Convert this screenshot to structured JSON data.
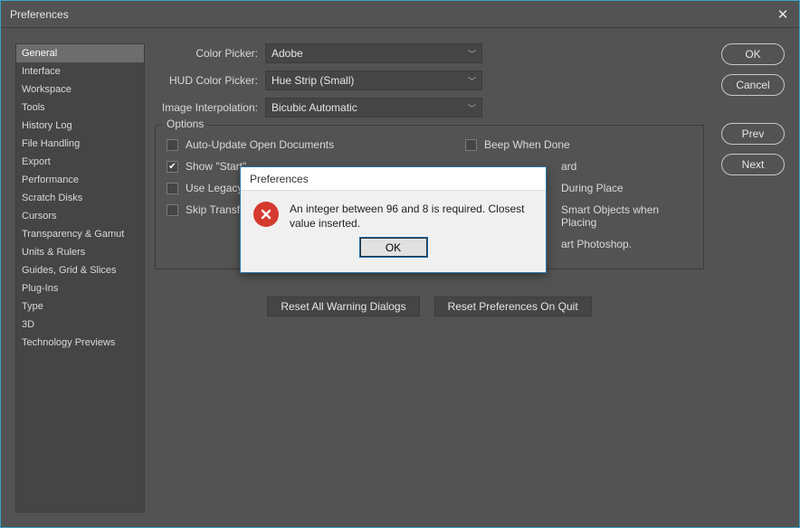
{
  "window": {
    "title": "Preferences"
  },
  "sidebar": {
    "items": [
      "General",
      "Interface",
      "Workspace",
      "Tools",
      "History Log",
      "File Handling",
      "Export",
      "Performance",
      "Scratch Disks",
      "Cursors",
      "Transparency & Gamut",
      "Units & Rulers",
      "Guides, Grid & Slices",
      "Plug-Ins",
      "Type",
      "3D",
      "Technology Previews"
    ],
    "selected_index": 0
  },
  "form": {
    "color_picker": {
      "label": "Color Picker:",
      "value": "Adobe"
    },
    "hud_color_picker": {
      "label": "HUD Color Picker:",
      "value": "Hue Strip (Small)"
    },
    "image_interpolation": {
      "label": "Image Interpolation:",
      "value": "Bicubic Automatic"
    }
  },
  "options": {
    "legend": "Options",
    "left": [
      {
        "label": "Auto-Update Open Documents",
        "checked": false
      },
      {
        "label": "Show \"Start\"",
        "checked": true,
        "truncated_full": "Show \"Start\" Workspace When No Documents Are Open"
      },
      {
        "label": "Use Legacy \"",
        "checked": false,
        "truncated_full": "Use Legacy \"New Document\" Interface"
      },
      {
        "label": "Skip Transfor",
        "checked": false,
        "truncated_full": "Skip Transform when Placing"
      }
    ],
    "right": [
      {
        "label": "Beep When Done",
        "checked": false
      },
      {
        "label_suffix": "ard",
        "checked_hidden": true
      },
      {
        "label_suffix": "During Place",
        "checked_hidden": true
      },
      {
        "label_suffix": "Smart Objects when Placing",
        "checked_hidden": true
      },
      {
        "label_suffix": "art Photoshop.",
        "is_note": true
      }
    ]
  },
  "buttons": {
    "reset_warnings": "Reset All Warning Dialogs",
    "reset_prefs": "Reset Preferences On Quit",
    "ok": "OK",
    "cancel": "Cancel",
    "prev": "Prev",
    "next": "Next"
  },
  "modal": {
    "title": "Preferences",
    "message": "An integer between 96 and 8 is required.  Closest value inserted.",
    "ok": "OK"
  }
}
